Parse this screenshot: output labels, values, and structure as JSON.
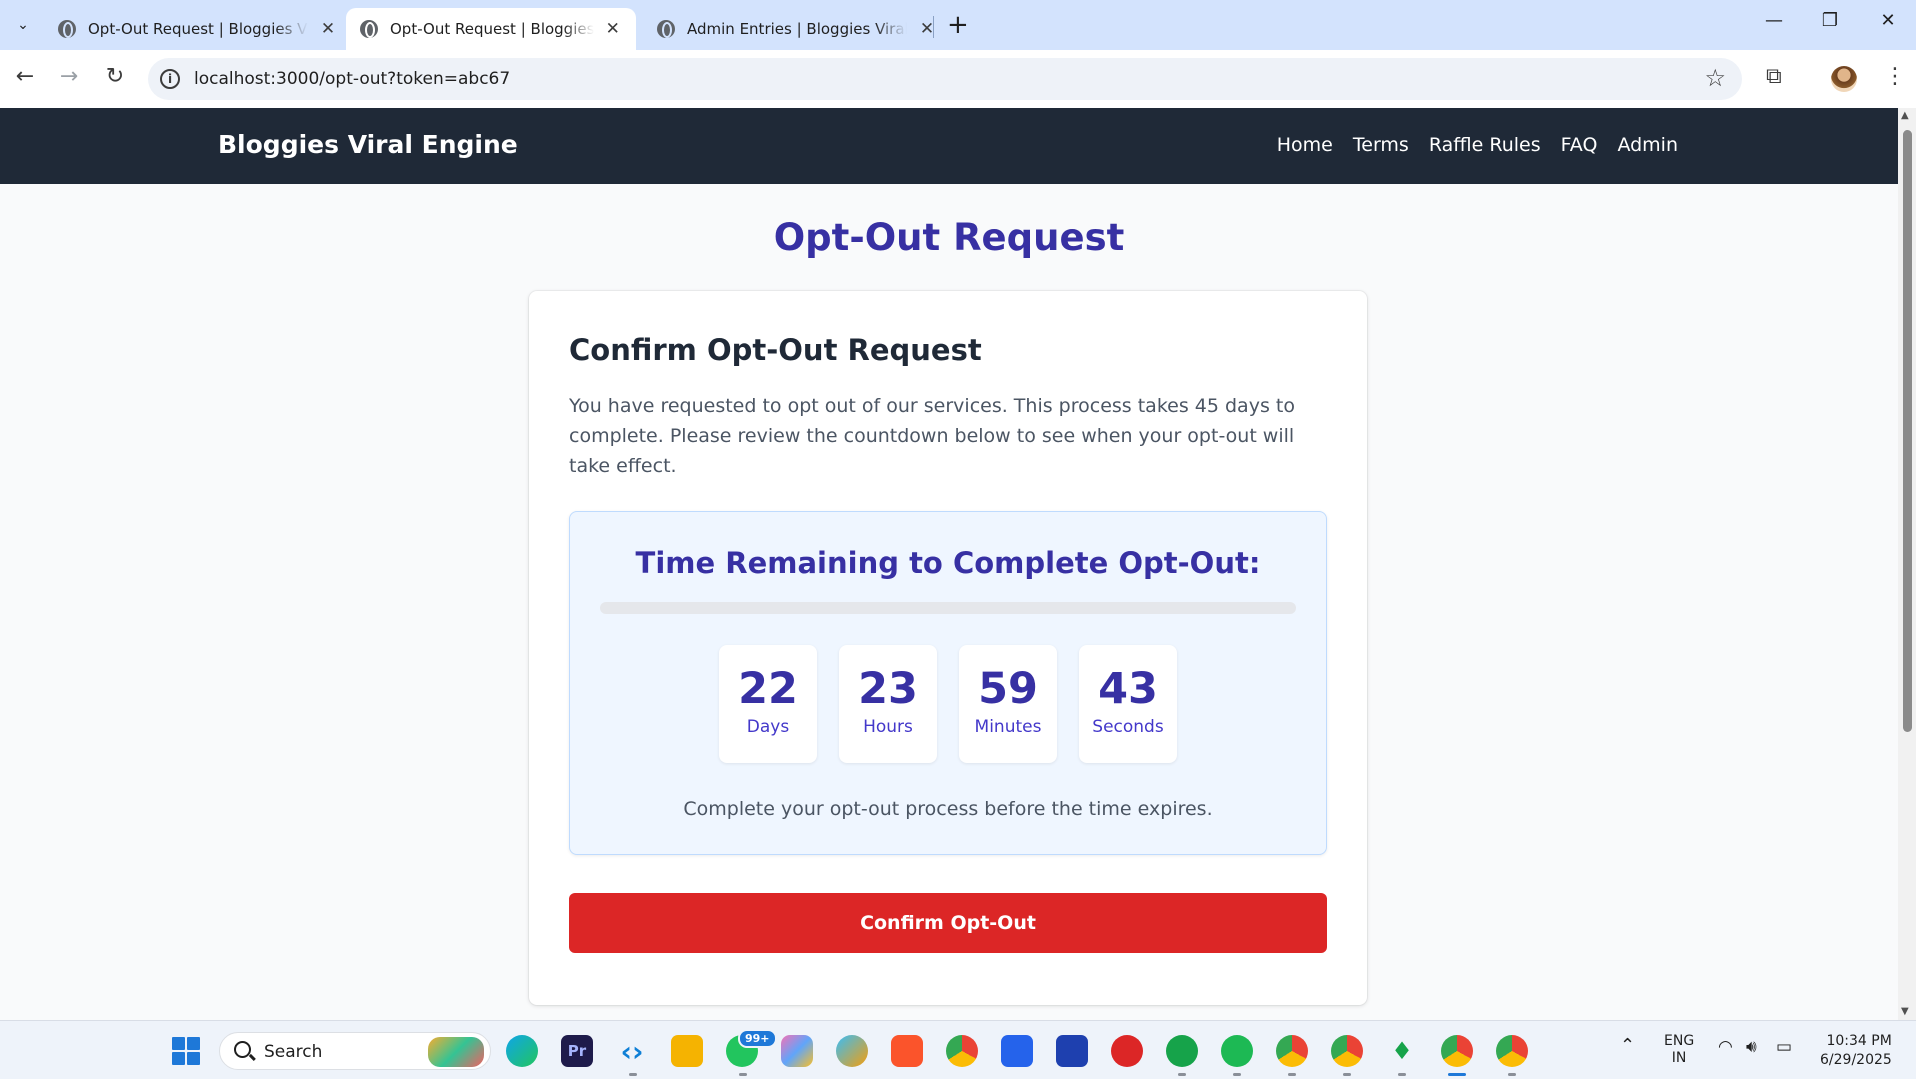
{
  "browser": {
    "tabs": [
      {
        "title": "Opt-Out Request | Bloggies Viral Engine",
        "active": false
      },
      {
        "title": "Opt-Out Request | Bloggies Viral Engine",
        "active": true
      },
      {
        "title": "Admin Entries | Bloggies Viral Engine",
        "active": false
      }
    ],
    "url": "localhost:3000/opt-out?token=abc67"
  },
  "site": {
    "brand": "Bloggies Viral Engine",
    "nav": [
      "Home",
      "Terms",
      "Raffle Rules",
      "FAQ",
      "Admin"
    ]
  },
  "page": {
    "title": "Opt-Out Request",
    "card": {
      "heading": "Confirm Opt-Out Request",
      "description": "You have requested to opt out of our services. This process takes 45 days to complete. Please review the countdown below to see when your opt-out will take effect.",
      "timer": {
        "title": "Time Remaining to Complete Opt-Out:",
        "progress_percent": 0,
        "units": [
          {
            "value": "22",
            "label": "Days"
          },
          {
            "value": "23",
            "label": "Hours"
          },
          {
            "value": "59",
            "label": "Minutes"
          },
          {
            "value": "43",
            "label": "Seconds"
          }
        ],
        "note": "Complete your opt-out process before the time expires."
      },
      "confirm_label": "Confirm Opt-Out"
    }
  },
  "taskbar": {
    "search_placeholder": "Search",
    "whatsapp_badge": "99+",
    "lang_line1": "ENG",
    "lang_line2": "IN",
    "time": "10:34 PM",
    "date": "6/29/2025"
  },
  "colors": {
    "nav_bg": "#1f2937",
    "accent": "#3730a3",
    "danger": "#dc2626",
    "timer_bg": "#eff6ff"
  }
}
